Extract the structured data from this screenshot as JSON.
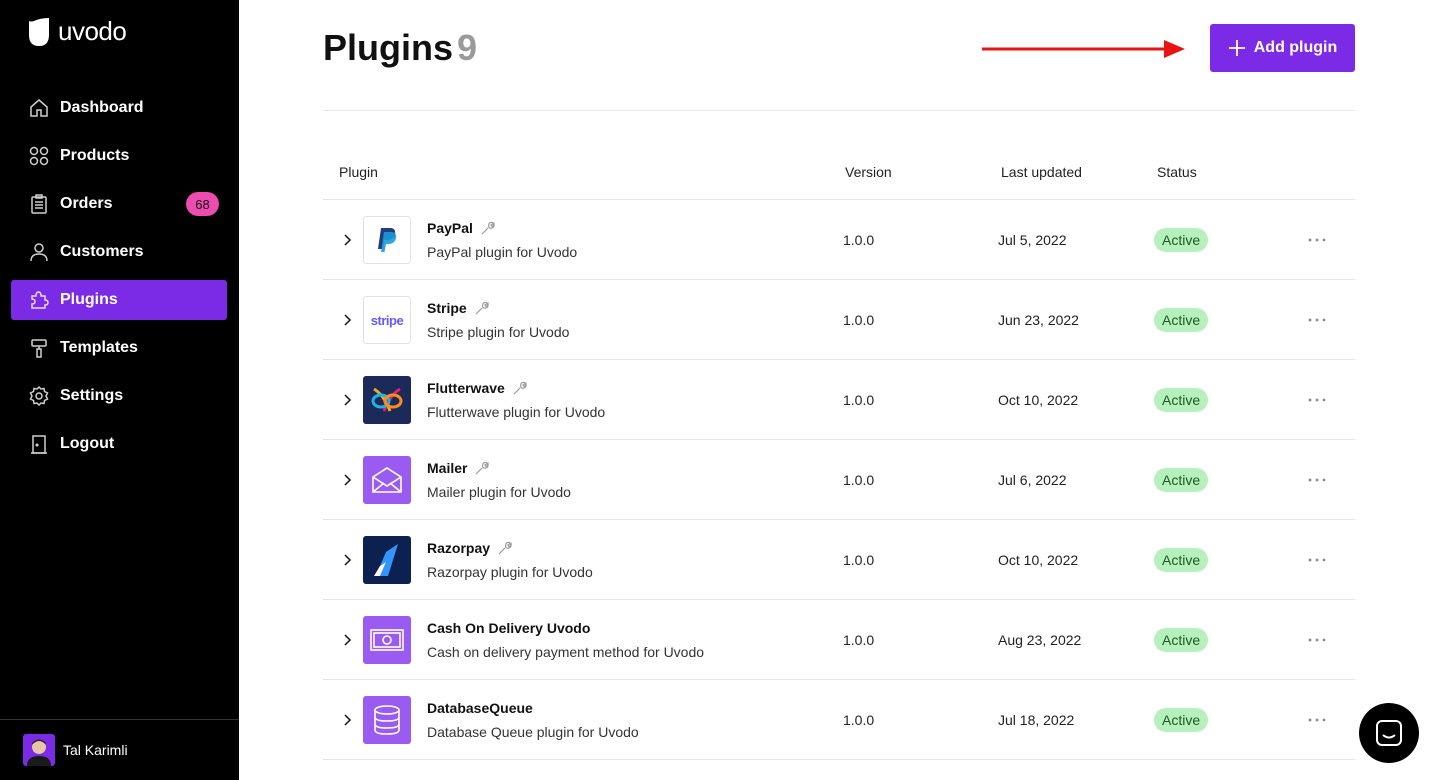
{
  "app": {
    "brand": "uvodo",
    "accent": "#7b2be6",
    "badge_color": "#ec4bb0",
    "status_color": "#b5f0bd"
  },
  "sidebar": {
    "items": [
      {
        "label": "Dashboard",
        "icon": "home-icon"
      },
      {
        "label": "Products",
        "icon": "grid-icon"
      },
      {
        "label": "Orders",
        "icon": "clipboard-icon",
        "badge": "68"
      },
      {
        "label": "Customers",
        "icon": "user-icon"
      },
      {
        "label": "Plugins",
        "icon": "puzzle-icon",
        "active": true
      },
      {
        "label": "Templates",
        "icon": "paint-roller-icon"
      },
      {
        "label": "Settings",
        "icon": "gear-icon"
      },
      {
        "label": "Logout",
        "icon": "door-icon"
      }
    ],
    "user": {
      "name": "Tal Karimli"
    }
  },
  "header": {
    "title": "Plugins",
    "count": "9",
    "add_label": "Add plugin"
  },
  "table": {
    "columns": [
      "Plugin",
      "Version",
      "Last updated",
      "Status"
    ],
    "rows": [
      {
        "name": "PayPal",
        "desc": "PayPal plugin for Uvodo",
        "version": "1.0.0",
        "updated": "Jul 5, 2022",
        "status": "Active",
        "logo": "paypal"
      },
      {
        "name": "Stripe",
        "desc": "Stripe plugin for Uvodo",
        "version": "1.0.0",
        "updated": "Jun 23, 2022",
        "status": "Active",
        "logo": "stripe",
        "logo_text": "stripe"
      },
      {
        "name": "Flutterwave",
        "desc": "Flutterwave plugin for Uvodo",
        "version": "1.0.0",
        "updated": "Oct 10, 2022",
        "status": "Active",
        "logo": "flutterwave"
      },
      {
        "name": "Mailer",
        "desc": "Mailer plugin for Uvodo",
        "version": "1.0.0",
        "updated": "Jul 6, 2022",
        "status": "Active",
        "logo": "mailer"
      },
      {
        "name": "Razorpay",
        "desc": "Razorpay plugin for Uvodo",
        "version": "1.0.0",
        "updated": "Oct 10, 2022",
        "status": "Active",
        "logo": "razorpay"
      },
      {
        "name": "Cash On Delivery Uvodo",
        "desc": "Cash on delivery payment method for Uvodo",
        "version": "1.0.0",
        "updated": "Aug 23, 2022",
        "status": "Active",
        "logo": "cash"
      },
      {
        "name": "DatabaseQueue",
        "desc": "Database Queue plugin for Uvodo",
        "version": "1.0.0",
        "updated": "Jul 18, 2022",
        "status": "Active",
        "logo": "database"
      }
    ]
  }
}
